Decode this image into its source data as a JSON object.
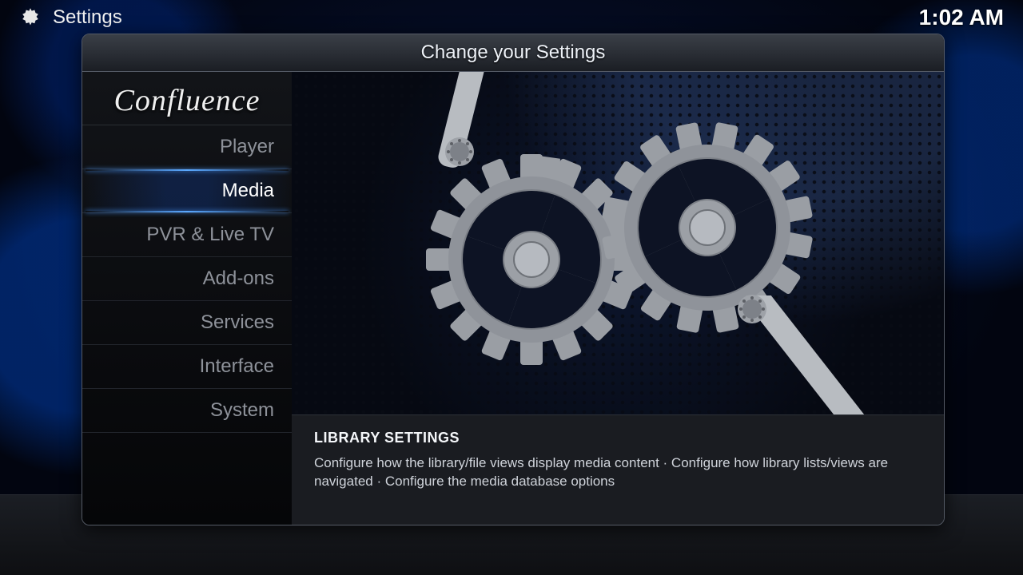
{
  "header": {
    "title": "Settings",
    "clock": "1:02 AM"
  },
  "window": {
    "title": "Change your Settings"
  },
  "sidebar": {
    "logo": "Confluence",
    "items": [
      {
        "label": "Player",
        "selected": false
      },
      {
        "label": "Media",
        "selected": true
      },
      {
        "label": "PVR & Live TV",
        "selected": false
      },
      {
        "label": "Add-ons",
        "selected": false
      },
      {
        "label": "Services",
        "selected": false
      },
      {
        "label": "Interface",
        "selected": false
      },
      {
        "label": "System",
        "selected": false
      }
    ]
  },
  "description": {
    "heading": "LIBRARY SETTINGS",
    "body": "Configure how the library/file views display media content ·  Configure how library lists/views are navigated · Configure the media database options"
  }
}
